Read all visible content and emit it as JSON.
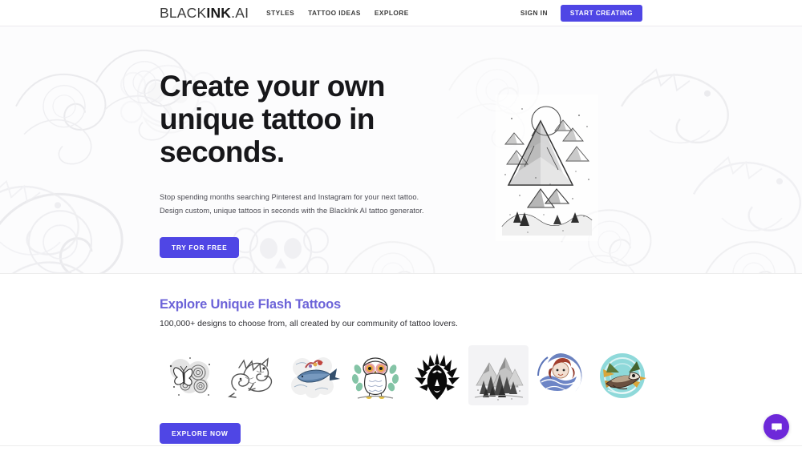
{
  "header": {
    "logo": {
      "part1": "BLACK",
      "part2": "INK",
      "part3": ".AI"
    },
    "nav": [
      {
        "label": "STYLES",
        "name": "nav-styles"
      },
      {
        "label": "TATTOO IDEAS",
        "name": "nav-tattoo-ideas"
      },
      {
        "label": "EXPLORE",
        "name": "nav-explore"
      }
    ],
    "sign_in": "SIGN IN",
    "start_creating": "START CREATING"
  },
  "hero": {
    "title_line1": "Create your own",
    "title_line2": "unique tattoo in",
    "title_line3": "seconds.",
    "subtitle_line1": "Stop spending months searching Pinterest and Instagram for your next tattoo.",
    "subtitle_line2": "Design custom, unique tattoos in seconds with the BlackInk AI tattoo generator.",
    "cta": "TRY FOR FREE",
    "artwork_name": "mountain-landscape-tattoo"
  },
  "explore": {
    "title": "Explore Unique Flash Tattoos",
    "subtitle": "100,000+ designs to choose from, all created by our community of tattoo lovers.",
    "cta": "EXPLORE NOW",
    "thumbnails": [
      {
        "name": "thumb-butterfly-roses",
        "alt": "butterfly and roses sketch",
        "active": false
      },
      {
        "name": "thumb-dragon",
        "alt": "oriental dragon sketch",
        "active": false
      },
      {
        "name": "thumb-whale",
        "alt": "whale and clouds color",
        "active": false
      },
      {
        "name": "thumb-owl",
        "alt": "owl with foliage color",
        "active": false
      },
      {
        "name": "thumb-tribal-eagle",
        "alt": "black tribal eagle",
        "active": false
      },
      {
        "name": "thumb-forest-mountains",
        "alt": "pine forest and mountains",
        "active": true
      },
      {
        "name": "thumb-koi-wave",
        "alt": "koi fish and wave circle",
        "active": false
      },
      {
        "name": "thumb-bird-circle",
        "alt": "bird in teal circle",
        "active": false
      }
    ]
  },
  "chat": {
    "label": "chat-bubble",
    "color": "#6d28d9"
  },
  "colors": {
    "accent": "#4f46e5",
    "explore_title": "#6c63d8",
    "chat": "#6d28d9",
    "hero_bg": "#fcfcfd",
    "text_dark": "#17171a"
  }
}
